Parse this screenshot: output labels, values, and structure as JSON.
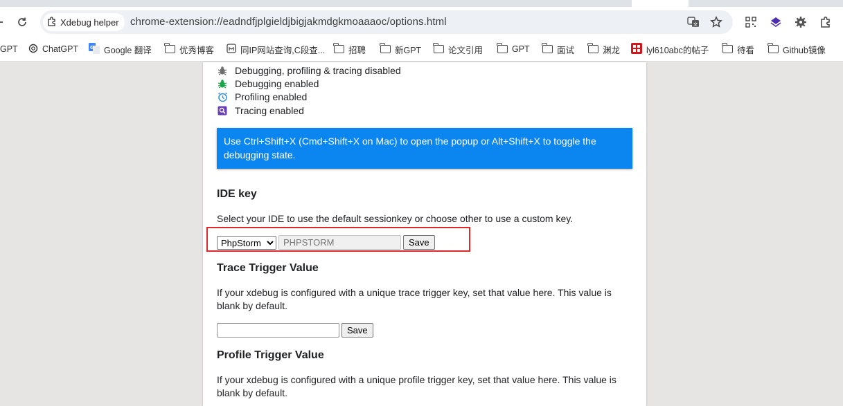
{
  "tab_bar": {},
  "toolbar": {
    "site_chip_label": "Xdebug helper",
    "url": "chrome-extension://eadndfjplgieldjbigjakmdgkmoaaaoc/options.html",
    "icons": [
      "back-arrow-icon",
      "reload-icon",
      "extension-puzzle-icon",
      "translate-icon",
      "star-icon",
      "qr-code-icon",
      "purple-diamond-extension-icon",
      "gear-extension-icon",
      "extensions-puzzle-icon"
    ]
  },
  "bookmarks": [
    {
      "label": "GPT",
      "icon": "none"
    },
    {
      "label": "ChatGPT",
      "icon": "openai-icon"
    },
    {
      "label": "Google 翻译",
      "icon": "google-translate-icon"
    },
    {
      "label": "优秀博客",
      "icon": "folder-icon"
    },
    {
      "label": "同IP网站查询,C段查...",
      "icon": "globe-icon"
    },
    {
      "label": "招聘",
      "icon": "folder-icon"
    },
    {
      "label": "新GPT",
      "icon": "folder-icon"
    },
    {
      "label": "论文引用",
      "icon": "folder-icon"
    },
    {
      "label": "GPT",
      "icon": "folder-icon"
    },
    {
      "label": "面试",
      "icon": "folder-icon"
    },
    {
      "label": "渊龙",
      "icon": "folder-icon"
    },
    {
      "label": "lyl610abc的帖子",
      "icon": "red-site-icon"
    },
    {
      "label": "待看",
      "icon": "folder-icon"
    },
    {
      "label": "Github镜像",
      "icon": "folder-icon"
    }
  ],
  "legend": [
    {
      "label": "Debugging, profiling & tracing disabled",
      "icon": "bug-gray-icon",
      "color": "#6f6f6f"
    },
    {
      "label": "Debugging enabled",
      "icon": "bug-green-icon",
      "color": "#1aa64a"
    },
    {
      "label": "Profiling enabled",
      "icon": "clock-blue-icon",
      "color": "#2f8fd8"
    },
    {
      "label": "Tracing enabled",
      "icon": "magnifier-purple-icon",
      "color": "#6a3fb5"
    }
  ],
  "info_banner": "Use Ctrl+Shift+X (Cmd+Shift+X on Mac) to open the popup or Alt+Shift+X to toggle the debugging state.",
  "ide_key": {
    "heading": "IDE key",
    "description": "Select your IDE to use the default sessionkey or choose other to use a custom key.",
    "selected": "PhpStorm",
    "placeholder": "PHPSTORM",
    "save_label": "Save"
  },
  "trace_trigger": {
    "heading": "Trace Trigger Value",
    "description": "If your xdebug is configured with a unique trace trigger key, set that value here. This value is blank by default.",
    "value": "",
    "save_label": "Save"
  },
  "profile_trigger": {
    "heading": "Profile Trigger Value",
    "description": "If your xdebug is configured with a unique profile trigger key, set that value here. This value is blank by default."
  },
  "colors": {
    "banner": "#0b86f1",
    "highlight": "#e0272a"
  }
}
